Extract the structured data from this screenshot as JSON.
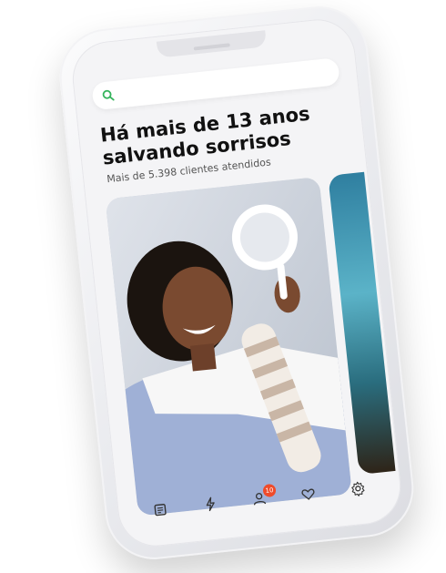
{
  "search": {
    "placeholder": ""
  },
  "hero": {
    "headline": "Há mais de 13 anos salvando sorrisos",
    "subline": "Mais de 5.398 clientes atendidos"
  },
  "tabbar": {
    "items": [
      {
        "icon": "document-icon"
      },
      {
        "icon": "lightning-icon"
      },
      {
        "icon": "user-icon",
        "badge": "10"
      },
      {
        "icon": "heart-icon"
      },
      {
        "icon": "gear-icon"
      }
    ]
  },
  "colors": {
    "accent": "#34b35b",
    "badge": "#ef4b2a",
    "text": "#111111",
    "subtext": "#555555"
  }
}
